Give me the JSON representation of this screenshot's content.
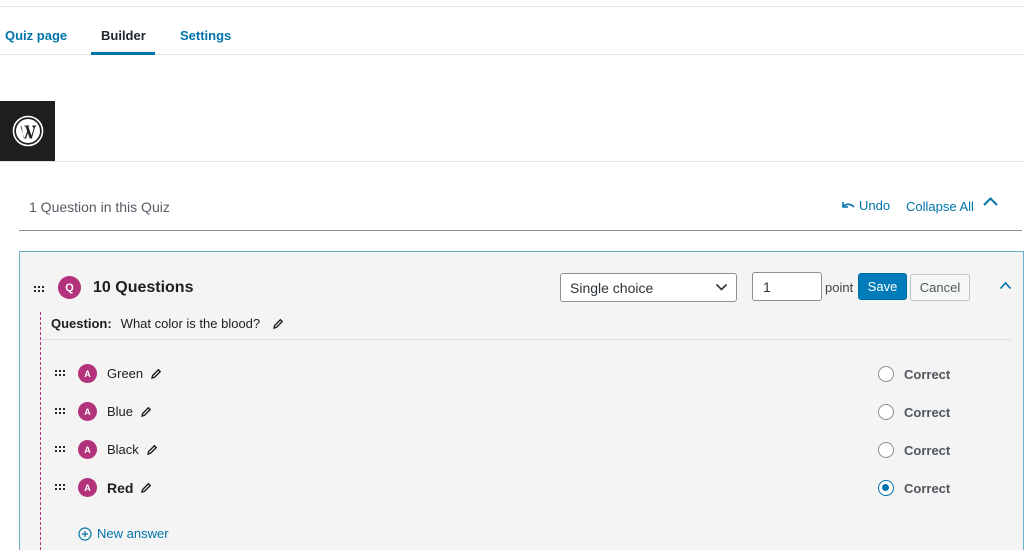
{
  "tabs": [
    {
      "label": "Quiz page"
    },
    {
      "label": "Builder"
    },
    {
      "label": "Settings"
    }
  ],
  "active_tab": "Builder",
  "summary": {
    "count_text": "1 Question in this Quiz",
    "undo_label": "Undo",
    "collapse_all_label": "Collapse All"
  },
  "question": {
    "badge": "Q",
    "title": "10 Questions",
    "type_value": "Single choice",
    "points_value": "1",
    "points_label": "point",
    "save_label": "Save",
    "cancel_label": "Cancel",
    "question_label": "Question:",
    "question_text": "What color is the blood?"
  },
  "answers": [
    {
      "badge": "A",
      "text": "Green",
      "correct_label": "Correct",
      "checked": false
    },
    {
      "badge": "A",
      "text": "Blue",
      "correct_label": "Correct",
      "checked": false
    },
    {
      "badge": "A",
      "text": "Black",
      "correct_label": "Correct",
      "checked": false
    },
    {
      "badge": "A",
      "text": "Red",
      "correct_label": "Correct",
      "checked": true
    }
  ],
  "new_answer_label": "New answer",
  "colors": {
    "accent": "#0073aa",
    "badge": "#b3327c",
    "panel_border": "#6bb0c9"
  },
  "icons": [
    "wordpress-logo-icon",
    "undo-icon",
    "chevron-up-icon",
    "chevron-down-icon",
    "drag-handle-icon",
    "pencil-icon",
    "plus-circle-icon"
  ]
}
